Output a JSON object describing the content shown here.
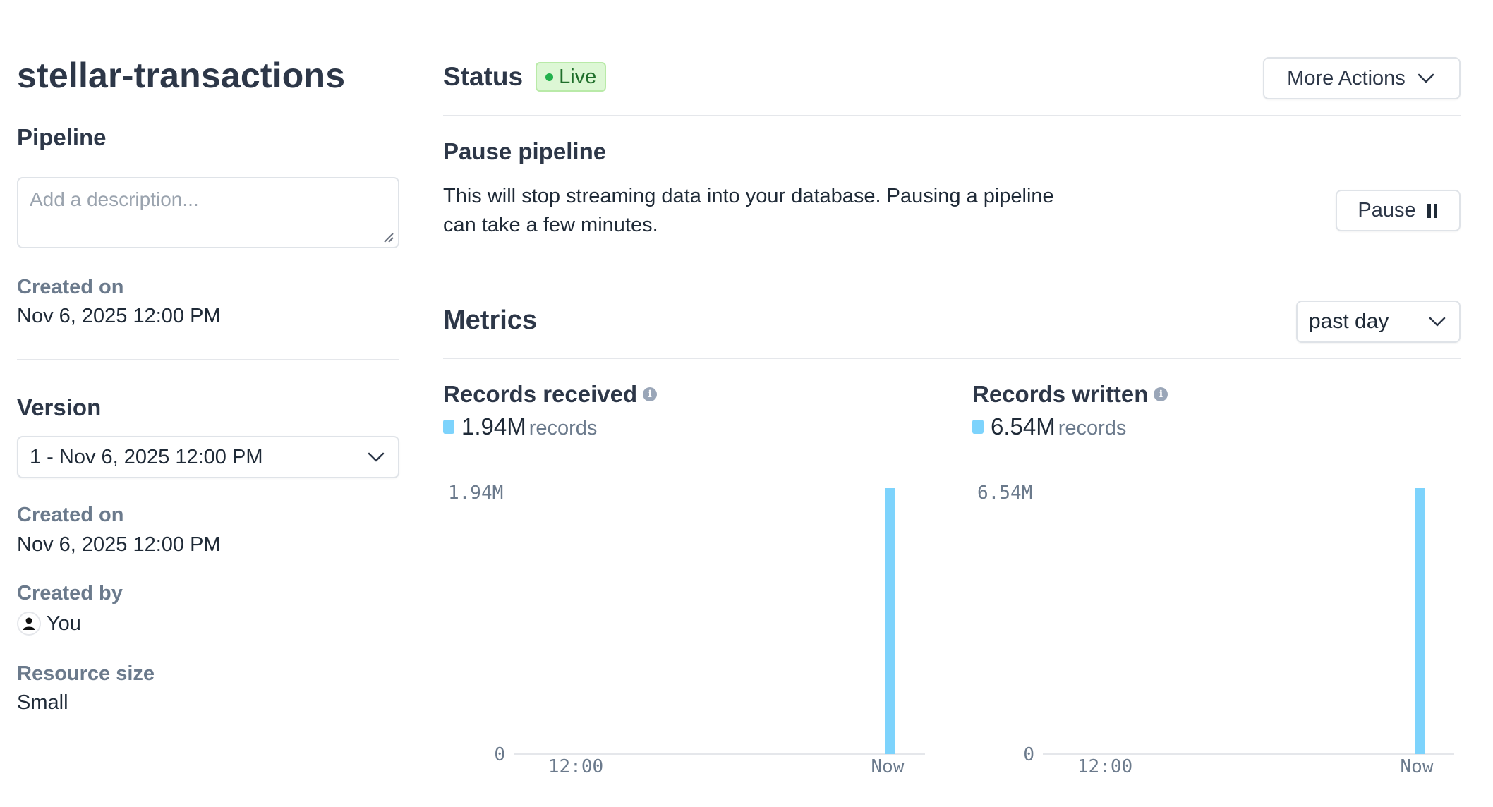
{
  "pipeline": {
    "name": "stellar-transactions",
    "section_label": "Pipeline",
    "description_placeholder": "Add a description...",
    "created_on_label": "Created on",
    "created_on": "Nov 6, 2025 12:00 PM"
  },
  "version": {
    "section_label": "Version",
    "selected": "1 - Nov 6, 2025 12:00 PM",
    "created_on_label": "Created on",
    "created_on": "Nov 6, 2025 12:00 PM",
    "created_by_label": "Created by",
    "created_by": "You",
    "resource_size_label": "Resource size",
    "resource_size": "Small"
  },
  "status": {
    "label": "Status",
    "badge": "Live",
    "badge_color": "#22b14c",
    "more_actions_label": "More Actions"
  },
  "pause": {
    "title": "Pause pipeline",
    "description": "This will stop streaming data into your database. Pausing a pipeline can take a few minutes.",
    "button_label": "Pause"
  },
  "metrics": {
    "title": "Metrics",
    "range_selected": "past day",
    "accent_color": "#7dd3fc"
  },
  "chart_data": [
    {
      "type": "bar",
      "title": "Records received",
      "total_value": "1.94M",
      "total_unit": "records",
      "x_tick_labels": [
        "12:00",
        "Now"
      ],
      "y_tick_labels": [
        "1.94M",
        "0"
      ],
      "ylim": [
        0,
        1940000
      ],
      "series": [
        {
          "name": "records",
          "points": [
            {
              "x": "Now",
              "value": 1940000
            }
          ]
        }
      ],
      "grid": false
    },
    {
      "type": "bar",
      "title": "Records written",
      "total_value": "6.54M",
      "total_unit": "records",
      "x_tick_labels": [
        "12:00",
        "Now"
      ],
      "y_tick_labels": [
        "6.54M",
        "0"
      ],
      "ylim": [
        0,
        6540000
      ],
      "series": [
        {
          "name": "records",
          "points": [
            {
              "x": "Now",
              "value": 6540000
            }
          ]
        }
      ],
      "grid": false
    }
  ]
}
